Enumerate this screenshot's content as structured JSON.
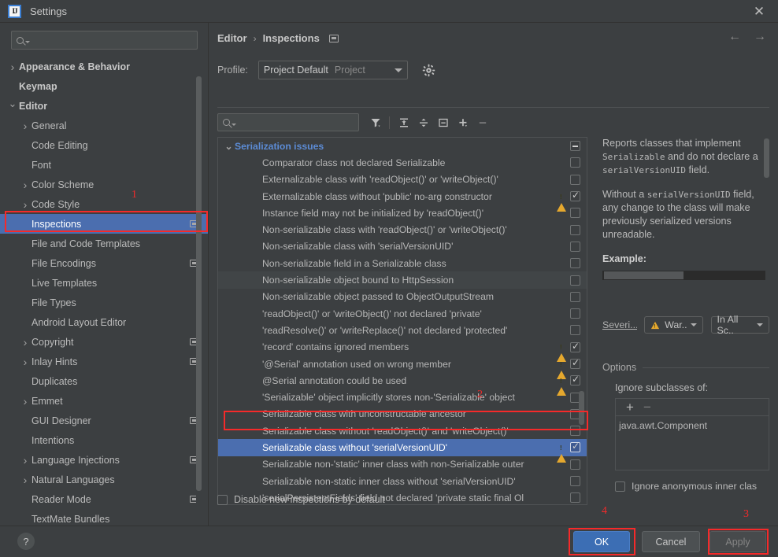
{
  "window": {
    "title": "Settings",
    "logo_text": "IJ",
    "close_icon": "close-icon"
  },
  "sidebar": {
    "search_placeholder": "",
    "search_value": "",
    "items": [
      {
        "label": "Appearance & Behavior",
        "indent": 0,
        "arrow": "collapsed",
        "bold": true,
        "badge": false,
        "selected": false
      },
      {
        "label": "Keymap",
        "indent": 0,
        "arrow": "none",
        "bold": true,
        "badge": false,
        "selected": false
      },
      {
        "label": "Editor",
        "indent": 0,
        "arrow": "expanded",
        "bold": true,
        "badge": false,
        "selected": false
      },
      {
        "label": "General",
        "indent": 1,
        "arrow": "collapsed",
        "bold": false,
        "badge": false,
        "selected": false
      },
      {
        "label": "Code Editing",
        "indent": 1,
        "arrow": "none",
        "bold": false,
        "badge": false,
        "selected": false
      },
      {
        "label": "Font",
        "indent": 1,
        "arrow": "none",
        "bold": false,
        "badge": false,
        "selected": false
      },
      {
        "label": "Color Scheme",
        "indent": 1,
        "arrow": "collapsed",
        "bold": false,
        "badge": false,
        "selected": false
      },
      {
        "label": "Code Style",
        "indent": 1,
        "arrow": "collapsed",
        "bold": false,
        "badge": false,
        "selected": false
      },
      {
        "label": "Inspections",
        "indent": 1,
        "arrow": "none",
        "bold": false,
        "badge": true,
        "selected": true
      },
      {
        "label": "File and Code Templates",
        "indent": 1,
        "arrow": "none",
        "bold": false,
        "badge": false,
        "selected": false
      },
      {
        "label": "File Encodings",
        "indent": 1,
        "arrow": "none",
        "bold": false,
        "badge": true,
        "selected": false
      },
      {
        "label": "Live Templates",
        "indent": 1,
        "arrow": "none",
        "bold": false,
        "badge": false,
        "selected": false
      },
      {
        "label": "File Types",
        "indent": 1,
        "arrow": "none",
        "bold": false,
        "badge": false,
        "selected": false
      },
      {
        "label": "Android Layout Editor",
        "indent": 1,
        "arrow": "none",
        "bold": false,
        "badge": false,
        "selected": false
      },
      {
        "label": "Copyright",
        "indent": 1,
        "arrow": "collapsed",
        "bold": false,
        "badge": true,
        "selected": false
      },
      {
        "label": "Inlay Hints",
        "indent": 1,
        "arrow": "collapsed",
        "bold": false,
        "badge": true,
        "selected": false
      },
      {
        "label": "Duplicates",
        "indent": 1,
        "arrow": "none",
        "bold": false,
        "badge": false,
        "selected": false
      },
      {
        "label": "Emmet",
        "indent": 1,
        "arrow": "collapsed",
        "bold": false,
        "badge": false,
        "selected": false
      },
      {
        "label": "GUI Designer",
        "indent": 1,
        "arrow": "none",
        "bold": false,
        "badge": true,
        "selected": false
      },
      {
        "label": "Intentions",
        "indent": 1,
        "arrow": "none",
        "bold": false,
        "badge": false,
        "selected": false
      },
      {
        "label": "Language Injections",
        "indent": 1,
        "arrow": "collapsed",
        "bold": false,
        "badge": true,
        "selected": false
      },
      {
        "label": "Natural Languages",
        "indent": 1,
        "arrow": "collapsed",
        "bold": false,
        "badge": false,
        "selected": false
      },
      {
        "label": "Reader Mode",
        "indent": 1,
        "arrow": "none",
        "bold": false,
        "badge": true,
        "selected": false
      },
      {
        "label": "TextMate Bundles",
        "indent": 1,
        "arrow": "none",
        "bold": false,
        "badge": false,
        "selected": false
      }
    ]
  },
  "main": {
    "breadcrumb": {
      "parent": "Editor",
      "separator": "›",
      "current": "Inspections"
    },
    "nav": {
      "back_icon": "arrow-left-icon",
      "forward_icon": "arrow-right-icon"
    },
    "profile": {
      "label": "Profile:",
      "value": "Project Default",
      "scope": "Project",
      "gear_icon": "gear-icon"
    },
    "toolbar": {
      "filter_placeholder": "",
      "filter_value": "",
      "icons": [
        "filter-icon",
        "expand-all-icon",
        "collapse-all-icon",
        "reset-icon",
        "add-icon",
        "remove-icon"
      ]
    },
    "disable_new_inspections": {
      "label": "Disable new inspections by default",
      "checked": false
    }
  },
  "inspections": {
    "group": {
      "label": "Serialization issues",
      "expanded": true,
      "state": "minus"
    },
    "rows": [
      {
        "label": "Comparator class not declared Serializable",
        "warn": false,
        "checked": false,
        "selected": false,
        "alt": false
      },
      {
        "label": "Externalizable class with 'readObject()' or 'writeObject()'",
        "warn": false,
        "checked": false,
        "selected": false,
        "alt": false
      },
      {
        "label": "Externalizable class without 'public' no-arg constructor",
        "warn": true,
        "checked": true,
        "selected": false,
        "alt": false
      },
      {
        "label": "Instance field may not be initialized by 'readObject()'",
        "warn": false,
        "checked": false,
        "selected": false,
        "alt": false
      },
      {
        "label": "Non-serializable class with 'readObject()' or 'writeObject()'",
        "warn": false,
        "checked": false,
        "selected": false,
        "alt": false
      },
      {
        "label": "Non-serializable class with 'serialVersionUID'",
        "warn": false,
        "checked": false,
        "selected": false,
        "alt": false
      },
      {
        "label": "Non-serializable field in a Serializable class",
        "warn": false,
        "checked": false,
        "selected": false,
        "alt": false
      },
      {
        "label": "Non-serializable object bound to HttpSession",
        "warn": false,
        "checked": false,
        "selected": false,
        "alt": true
      },
      {
        "label": "Non-serializable object passed to ObjectOutputStream",
        "warn": false,
        "checked": false,
        "selected": false,
        "alt": false
      },
      {
        "label": "'readObject()' or 'writeObject()' not declared 'private'",
        "warn": false,
        "checked": false,
        "selected": false,
        "alt": false
      },
      {
        "label": "'readResolve()' or 'writeReplace()' not declared 'protected'",
        "warn": false,
        "checked": false,
        "selected": false,
        "alt": false
      },
      {
        "label": "'record' contains ignored members",
        "warn": true,
        "checked": true,
        "selected": false,
        "alt": false
      },
      {
        "label": "'@Serial' annotation used on wrong member",
        "warn": true,
        "checked": true,
        "selected": false,
        "alt": false
      },
      {
        "label": "@Serial annotation could be used",
        "warn": true,
        "checked": true,
        "selected": false,
        "alt": false
      },
      {
        "label": "'Serializable' object implicitly stores non-'Serializable' object",
        "warn": false,
        "checked": false,
        "selected": false,
        "alt": false
      },
      {
        "label": "Serializable class with unconstructable ancestor",
        "warn": false,
        "checked": false,
        "selected": false,
        "alt": false
      },
      {
        "label": "Serializable class without 'readObject()' and 'writeObject()'",
        "warn": false,
        "checked": false,
        "selected": false,
        "alt": false
      },
      {
        "label": "Serializable class without 'serialVersionUID'",
        "warn": true,
        "checked": true,
        "selected": true,
        "alt": false
      },
      {
        "label": "Serializable non-'static' inner class with non-Serializable outer",
        "warn": false,
        "checked": false,
        "selected": false,
        "alt": false
      },
      {
        "label": "Serializable non-static inner class without 'serialVersionUID'",
        "warn": false,
        "checked": false,
        "selected": false,
        "alt": false
      },
      {
        "label": "'serialPersistentFields' field not declared 'private static final Ol",
        "warn": false,
        "checked": false,
        "selected": false,
        "alt": false
      }
    ]
  },
  "description": {
    "paragraph1_a": "Reports classes that implement ",
    "paragraph1_code1": "Serializable",
    "paragraph1_b": " and do not declare a ",
    "paragraph1_code2": "serialVersionUID",
    "paragraph1_c": " field.",
    "paragraph2_a": "Without a ",
    "paragraph2_code": "serialVersionUID",
    "paragraph2_b": " field, any change to the class will make previously serialized versions unreadable.",
    "example_label": "Example:"
  },
  "severity": {
    "label": "Severi...",
    "value": "War..",
    "scope": "In All Sc..",
    "warn_icon": "warning-triangle-icon"
  },
  "options": {
    "header": "Options",
    "ignore_subclasses_label": "Ignore subclasses of:",
    "add_icon": "+",
    "remove_icon": "−",
    "entries": [
      "java.awt.Component"
    ],
    "ignore_anonymous": {
      "label": "Ignore anonymous inner clas",
      "checked": false
    }
  },
  "footer": {
    "help_icon": "?",
    "ok_label": "OK",
    "cancel_label": "Cancel",
    "apply_label": "Apply"
  },
  "annotations": [
    {
      "num": "1"
    },
    {
      "num": "2"
    },
    {
      "num": "3"
    },
    {
      "num": "4"
    }
  ],
  "colors": {
    "background": "#3c3f41",
    "selection": "#4b6eaf",
    "group_text": "#5c8cd6",
    "warning": "#e5a82e",
    "annotation": "#f52a2a",
    "ok_button": "#3c6eb4"
  }
}
